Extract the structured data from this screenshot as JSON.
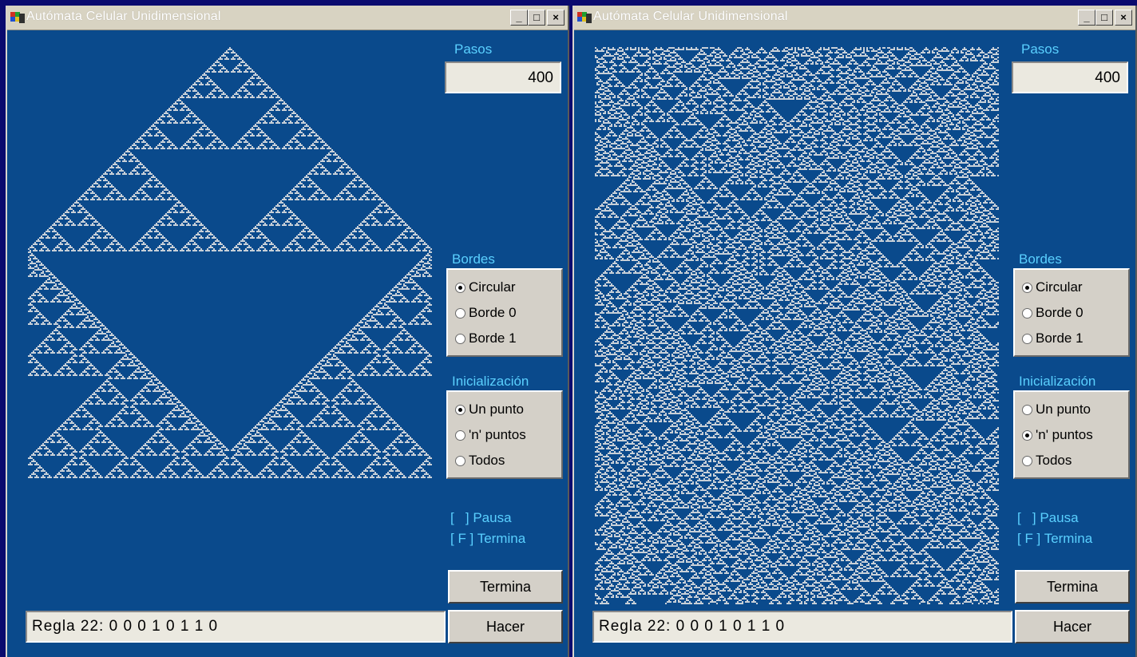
{
  "windows": [
    {
      "id": "left",
      "title": "Autómata Celular Unidimensional",
      "pasos_label": "Pasos",
      "pasos_value": "400",
      "bordes_label": "Bordes",
      "bordes_options": [
        "Circular",
        "Borde 0",
        "Borde 1"
      ],
      "bordes_selected": "Circular",
      "init_label": "Inicialización",
      "init_options": [
        "Un punto",
        "'n' puntos",
        "Todos"
      ],
      "init_selected": "Un punto",
      "pausa_text": "[   ] Pausa",
      "termina_key_text": "[ F ] Termina",
      "termina_button": "Termina",
      "hacer_button": "Hacer",
      "regla_text": "Regla 22: 0 0 0 1 0 1 1 0",
      "pattern": "single-point"
    },
    {
      "id": "right",
      "title": "Autómata Celular Unidimensional",
      "pasos_label": "Pasos",
      "pasos_value": "400",
      "bordes_label": "Bordes",
      "bordes_options": [
        "Circular",
        "Borde 0",
        "Borde 1"
      ],
      "bordes_selected": "Circular",
      "init_label": "Inicialización",
      "init_options": [
        "Un punto",
        "'n' puntos",
        "Todos"
      ],
      "init_selected": "'n' puntos",
      "pausa_text": "[   ] Pausa",
      "termina_key_text": "[ F ] Termina",
      "termina_button": "Termina",
      "hacer_button": "Hacer",
      "regla_text": "Regla 22: 0 0 0 1 0 1 1 0",
      "pattern": "random"
    }
  ],
  "rule": 22,
  "colors": {
    "background": "#0a4a8c",
    "cells": "#c8d0d8",
    "labels": "#5ad0ff",
    "titlebar": "#d8d3c2",
    "desktop": "#0a0a6e"
  },
  "icons": [
    "app-icon",
    "minimize-icon",
    "maximize-icon",
    "close-icon"
  ]
}
